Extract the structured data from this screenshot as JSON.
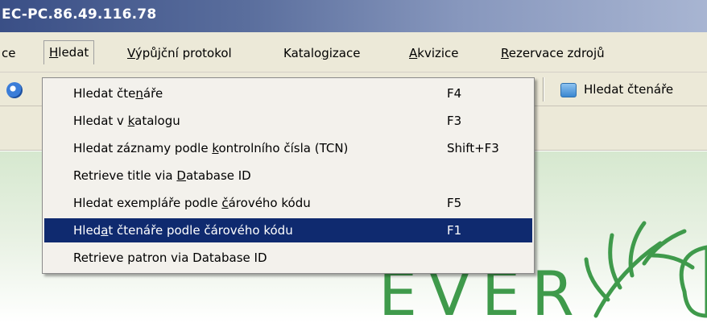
{
  "window": {
    "title": "EC-PC.86.49.116.78"
  },
  "menubar": {
    "items": [
      {
        "pre": "ce",
        "acc": "",
        "post": ""
      },
      {
        "pre": "",
        "acc": "H",
        "post": "ledat"
      },
      {
        "pre": "",
        "acc": "V",
        "post": "ýpůjční protokol"
      },
      {
        "pre": "Katalo",
        "acc": "g",
        "post": "izace"
      },
      {
        "pre": "",
        "acc": "A",
        "post": "kvizice"
      },
      {
        "pre": "",
        "acc": "R",
        "post": "ezervace zdrojů"
      }
    ]
  },
  "toolbar": {
    "patron_button_label": "Hledat čtenáře"
  },
  "dropdown": {
    "items": [
      {
        "pre": "Hledat čte",
        "acc": "n",
        "post": "áře",
        "shortcut": "F4"
      },
      {
        "pre": "Hledat v ",
        "acc": "k",
        "post": "atalogu",
        "shortcut": "F3"
      },
      {
        "pre": "Hledat záznamy podle ",
        "acc": "k",
        "post": "ontrolního čísla (TCN)",
        "shortcut": "Shift+F3"
      },
      {
        "pre": "Retrieve title via ",
        "acc": "D",
        "post": "atabase ID",
        "shortcut": ""
      },
      {
        "pre": "Hledat exempláře podle ",
        "acc": "č",
        "post": "árového kódu",
        "shortcut": "F5"
      },
      {
        "pre": "Hled",
        "acc": "a",
        "post": "t  čtenáře podle čárového kódu",
        "shortcut": "F1"
      },
      {
        "pre": "Retrieve patron via Database ID",
        "acc": "",
        "post": "",
        "shortcut": ""
      }
    ],
    "highlighted_index": 5
  },
  "logo": {
    "text": "EVER"
  },
  "colors": {
    "highlight": "#0f2a6f",
    "menu_bg": "#ece9d8",
    "logo_green": "#3f9a4b"
  }
}
